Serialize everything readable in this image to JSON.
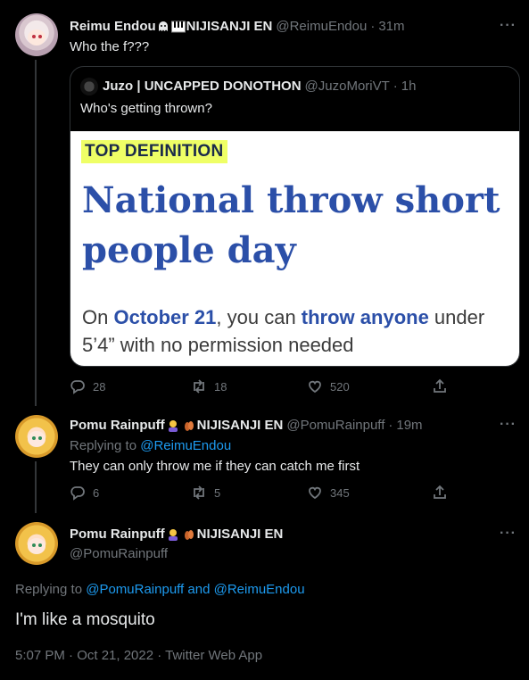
{
  "tweet1": {
    "author_name": "Reimu Endou",
    "author_suffix": "NIJISANJI EN",
    "handle": "@ReimuEndou",
    "dot": "·",
    "time": "31m",
    "text": "Who the f???",
    "quote": {
      "author_name": "Juzo | UNCAPPED DONOTHON",
      "handle": "@JuzoMoriVT",
      "dot": "·",
      "time": "1h",
      "text": "Who's getting thrown?",
      "image": {
        "label": "TOP DEFINITION",
        "term": "National throw short people day",
        "meaning_parts": [
          "On ",
          "October 21",
          ", you can ",
          "throw anyone",
          " under 5’4” with no permission needed"
        ]
      }
    },
    "stats": {
      "replies": "28",
      "retweets": "18",
      "likes": "520"
    }
  },
  "tweet2": {
    "author_name": "Pomu Rainpuff",
    "author_suffix": "NIJISANJI EN",
    "handle": "@PomuRainpuff",
    "dot": "·",
    "time": "19m",
    "replying_prefix": "Replying to",
    "replying_to": "@ReimuEndou",
    "text": "They can only throw me if they can catch me first",
    "stats": {
      "replies": "6",
      "retweets": "5",
      "likes": "345"
    }
  },
  "main_tweet": {
    "author_name": "Pomu Rainpuff",
    "author_suffix": "NIJISANJI EN",
    "handle": "@PomuRainpuff",
    "replying_prefix": "Replying to",
    "replying_to_1": "@PomuRainpuff",
    "replying_and": "and",
    "replying_to_2": "@ReimuEndou",
    "text": "I'm like a mosquito",
    "timestamp": "5:07 PM · Oct 21, 2022 · Twitter Web App"
  },
  "more_label": "···",
  "colors": {
    "background": "#000000",
    "text": "#e7e9ea",
    "muted": "#71767b",
    "link": "#1d9bf0"
  }
}
